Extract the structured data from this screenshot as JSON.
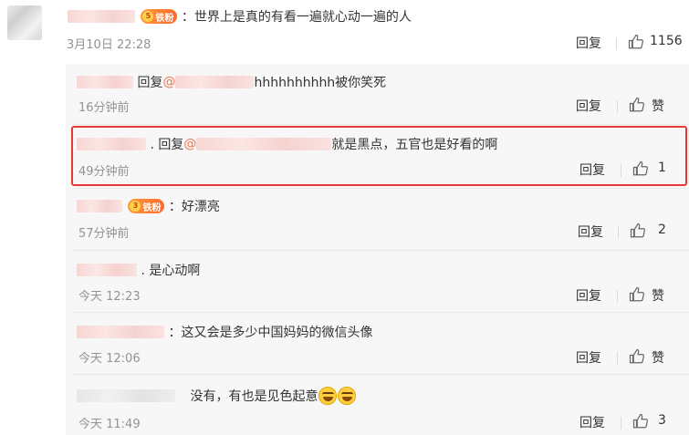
{
  "main_comment": {
    "badge": "铁粉",
    "badge_level": "5",
    "text": "：世界上是真的有看一遍就心动一遍的人",
    "time": "3月10日 22:28",
    "reply_label": "回复",
    "likes": "1156"
  },
  "replies": [
    {
      "prefix": "回复",
      "mention": "@",
      "text": "hhhhhhhhhh被你笑死",
      "time": "16分钟前",
      "reply_label": "回复",
      "likes": "赞"
    },
    {
      "prefix": ". 回复",
      "mention": "@",
      "text": "就是黑点，五官也是好看的啊",
      "time": "49分钟前",
      "reply_label": "回复",
      "likes": "1"
    },
    {
      "badge": "铁粉",
      "badge_level": "3",
      "text": "：好漂亮",
      "time": "57分钟前",
      "reply_label": "回复",
      "likes": "2"
    },
    {
      "text": ". 是心动啊",
      "time": "今天 12:23",
      "reply_label": "回复",
      "likes": "赞"
    },
    {
      "text": "：这又会是多少中国妈妈的微信头像",
      "time": "今天 12:06",
      "reply_label": "回复",
      "likes": "赞"
    },
    {
      "text": "没有，有也是见色起意",
      "time": "今天 11:49",
      "reply_label": "回复",
      "likes": "3"
    }
  ]
}
